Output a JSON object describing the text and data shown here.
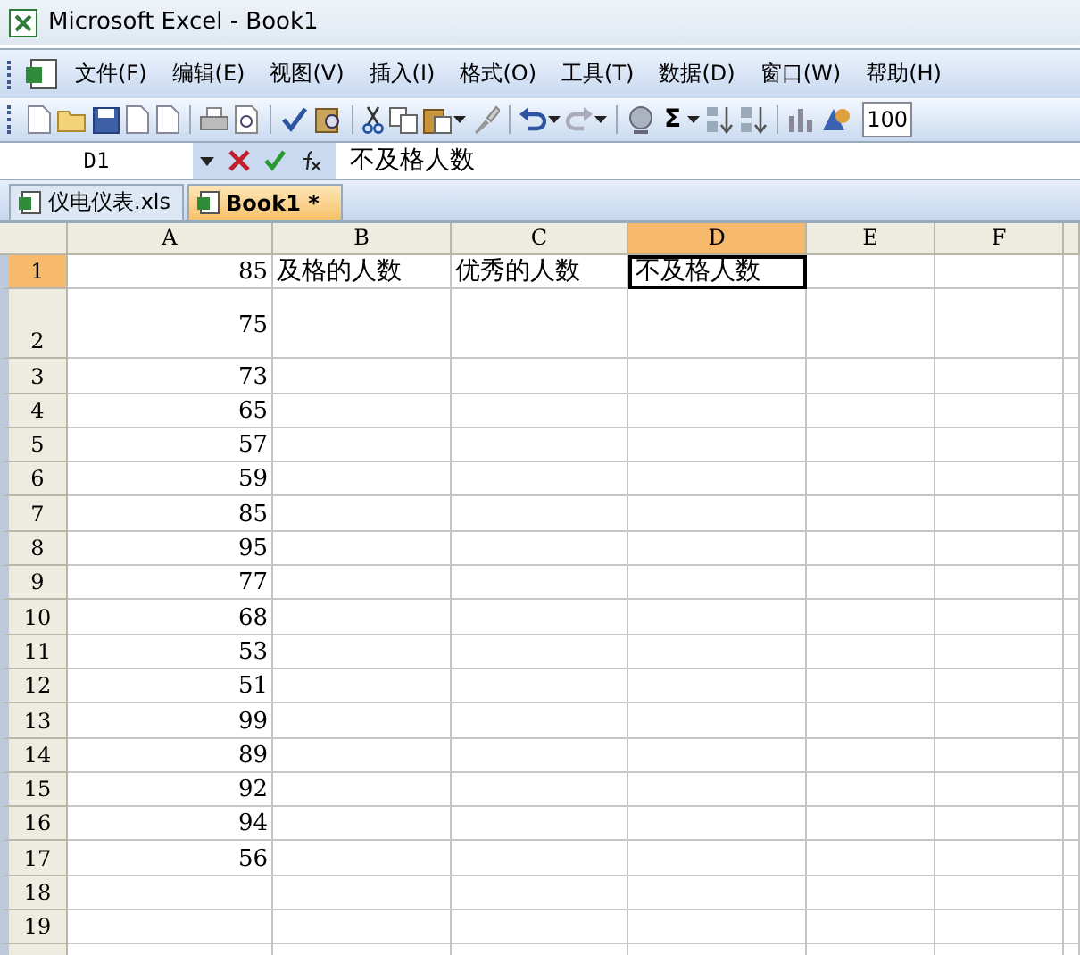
{
  "window": {
    "title": "Microsoft Excel - Book1"
  },
  "menu": [
    "文件(F)",
    "编辑(E)",
    "视图(V)",
    "插入(I)",
    "格式(O)",
    "工具(T)",
    "数据(D)",
    "窗口(W)",
    "帮助(H)"
  ],
  "toolbar": {
    "autosum": "Σ",
    "zoom": "100"
  },
  "formula_bar": {
    "name_box": "D1",
    "formula": "不及格人数"
  },
  "tabs": [
    {
      "label": "仪电仪表.xls",
      "selected": false
    },
    {
      "label": "Book1 *",
      "selected": true
    }
  ],
  "columns": [
    {
      "label": "A",
      "selected": false
    },
    {
      "label": "B",
      "selected": false
    },
    {
      "label": "C",
      "selected": false
    },
    {
      "label": "D",
      "selected": true
    },
    {
      "label": "E",
      "selected": false
    },
    {
      "label": "F",
      "selected": false
    }
  ],
  "rows": [
    {
      "label": "1",
      "selected": true,
      "cells": [
        {
          "text": "85",
          "kind": "number",
          "selected": false
        },
        {
          "text": "及格的人数",
          "kind": "text",
          "selected": false
        },
        {
          "text": "优秀的人数",
          "kind": "text",
          "selected": false
        },
        {
          "text": "不及格人数",
          "kind": "text",
          "selected": true
        }
      ]
    },
    {
      "label": "2",
      "selected": false,
      "cells": [
        {
          "text": "75",
          "kind": "number",
          "selected": false
        }
      ]
    },
    {
      "label": "3",
      "selected": false,
      "cells": [
        {
          "text": "73",
          "kind": "number",
          "selected": false
        }
      ]
    },
    {
      "label": "4",
      "selected": false,
      "cells": [
        {
          "text": "65",
          "kind": "number",
          "selected": false
        }
      ]
    },
    {
      "label": "5",
      "selected": false,
      "cells": [
        {
          "text": "57",
          "kind": "number",
          "selected": false
        }
      ]
    },
    {
      "label": "6",
      "selected": false,
      "cells": [
        {
          "text": "59",
          "kind": "number",
          "selected": false
        }
      ]
    },
    {
      "label": "7",
      "selected": false,
      "cells": [
        {
          "text": "85",
          "kind": "number",
          "selected": false
        }
      ]
    },
    {
      "label": "8",
      "selected": false,
      "cells": [
        {
          "text": "95",
          "kind": "number",
          "selected": false
        }
      ]
    },
    {
      "label": "9",
      "selected": false,
      "cells": [
        {
          "text": "77",
          "kind": "number",
          "selected": false
        }
      ]
    },
    {
      "label": "10",
      "selected": false,
      "cells": [
        {
          "text": "68",
          "kind": "number",
          "selected": false
        }
      ]
    },
    {
      "label": "11",
      "selected": false,
      "cells": [
        {
          "text": "53",
          "kind": "number",
          "selected": false
        }
      ]
    },
    {
      "label": "12",
      "selected": false,
      "cells": [
        {
          "text": "51",
          "kind": "number",
          "selected": false
        }
      ]
    },
    {
      "label": "13",
      "selected": false,
      "cells": [
        {
          "text": "99",
          "kind": "number",
          "selected": false
        }
      ]
    },
    {
      "label": "14",
      "selected": false,
      "cells": [
        {
          "text": "89",
          "kind": "number",
          "selected": false
        }
      ]
    },
    {
      "label": "15",
      "selected": false,
      "cells": [
        {
          "text": "92",
          "kind": "number",
          "selected": false
        }
      ]
    },
    {
      "label": "16",
      "selected": false,
      "cells": [
        {
          "text": "94",
          "kind": "number",
          "selected": false
        }
      ]
    },
    {
      "label": "17",
      "selected": false,
      "cells": [
        {
          "text": "56",
          "kind": "number",
          "selected": false
        }
      ]
    },
    {
      "label": "18",
      "selected": false,
      "cells": []
    },
    {
      "label": "19",
      "selected": false,
      "cells": []
    }
  ]
}
